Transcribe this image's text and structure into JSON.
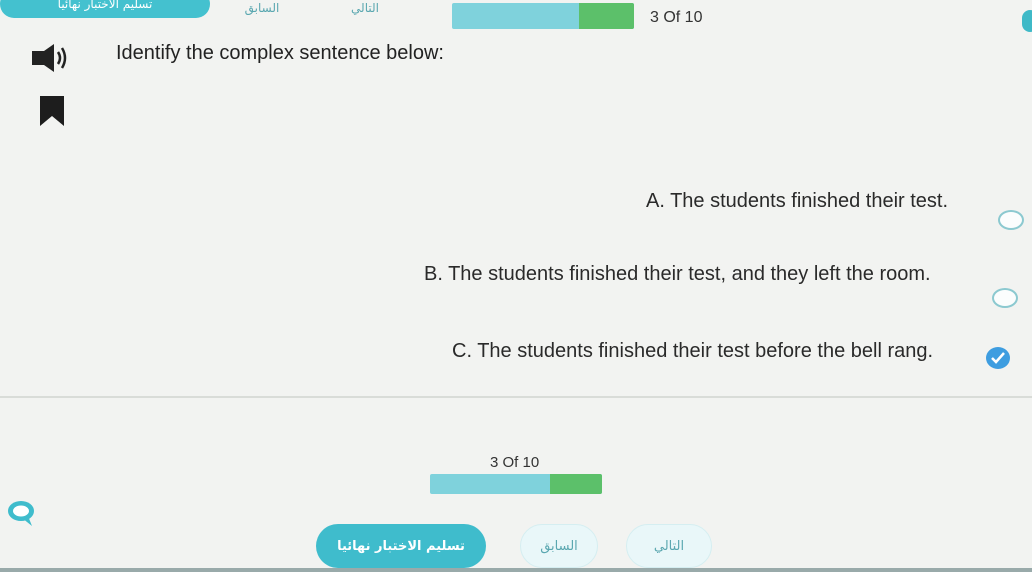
{
  "top_bar": {
    "submit_label": "تسليم الاختبار نهائيا",
    "prev_label": "السابق",
    "next_label": "التالي",
    "counter": "3 Of 10",
    "progress_fraction": 0.3
  },
  "question": {
    "prompt": "Identify the complex sentence below:"
  },
  "options": [
    {
      "label": "A. The students finished their test.",
      "selected": false
    },
    {
      "label": "B. The students finished their test, and they left the room.",
      "selected": false
    },
    {
      "label": "C. The students finished their test before the bell rang.",
      "selected": true
    }
  ],
  "bottom_bar": {
    "counter": "3 Of 10",
    "progress_fraction": 0.3,
    "submit_label": "تسليم الاختبار نهائيا",
    "prev_label": "السابق",
    "next_label": "التالي"
  },
  "icons": {
    "speaker": "speaker-icon",
    "bookmark": "bookmark-icon",
    "chat": "chat-icon",
    "check": "check-icon"
  },
  "colors": {
    "accent": "#3fbccc",
    "progress_done": "#5cc06a",
    "progress_remaining": "#7fd2dc",
    "selected_radio": "#3e9de0"
  }
}
